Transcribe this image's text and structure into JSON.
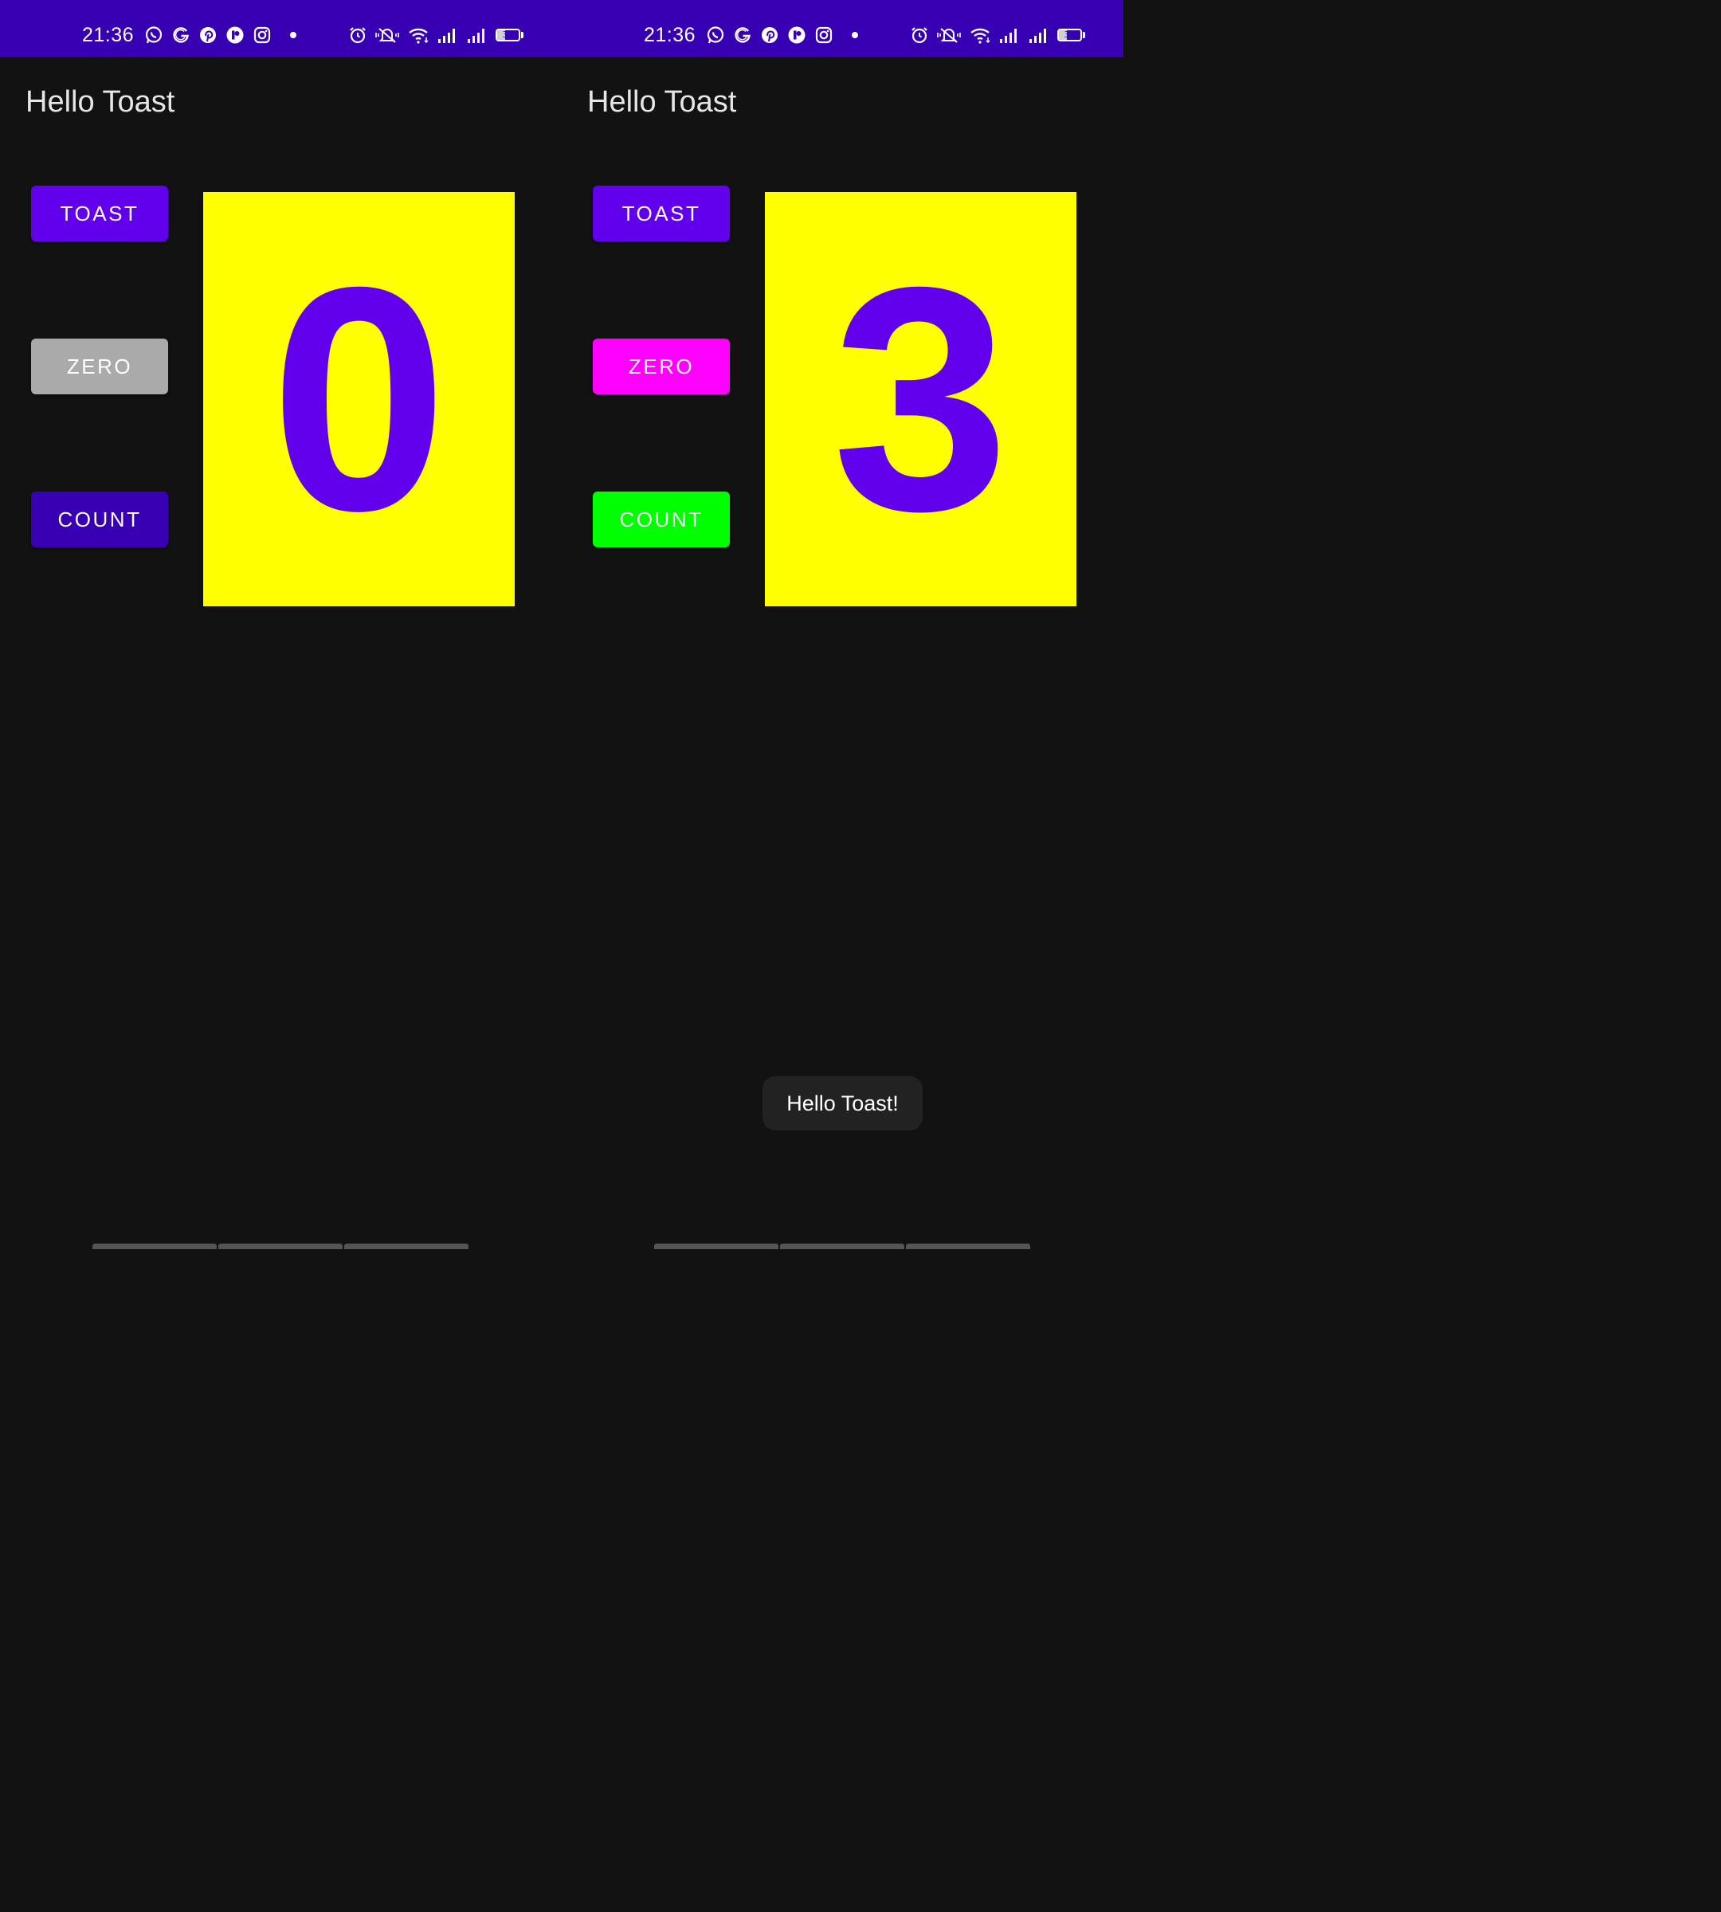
{
  "colors": {
    "status_bar": "#3700b3",
    "background": "#121212",
    "count_box_bg": "#ffff00",
    "count_text": "#6200ee",
    "toast_bg": "#222222"
  },
  "screens": [
    {
      "status_bar": {
        "time": "21:36",
        "battery_level": "37",
        "left_icons": [
          "whatsapp-icon",
          "google-icon",
          "pinterest-icon",
          "app-icon",
          "instagram-icon",
          "dot-icon"
        ],
        "right_icons": [
          "alarm-icon",
          "mute-icon",
          "wifi-icon",
          "signal-icon",
          "signal-icon",
          "battery-icon"
        ]
      },
      "app": {
        "title": "Hello Toast"
      },
      "buttons": {
        "toast": {
          "label": "TOAST",
          "color": "#6200ee"
        },
        "zero": {
          "label": "ZERO",
          "color": "#aaaaaa"
        },
        "count": {
          "label": "COUNT",
          "color": "#3700b3"
        }
      },
      "count_value": "0",
      "toast_message": ""
    },
    {
      "status_bar": {
        "time": "21:36",
        "battery_level": "37",
        "left_icons": [
          "whatsapp-icon",
          "google-icon",
          "pinterest-icon",
          "app-icon",
          "instagram-icon",
          "dot-icon"
        ],
        "right_icons": [
          "alarm-icon",
          "mute-icon",
          "wifi-icon",
          "signal-icon",
          "signal-icon",
          "battery-icon"
        ]
      },
      "app": {
        "title": "Hello Toast"
      },
      "buttons": {
        "toast": {
          "label": "TOAST",
          "color": "#6200ee"
        },
        "zero": {
          "label": "ZERO",
          "color": "#ff00ff"
        },
        "count": {
          "label": "COUNT",
          "color": "#00ff00"
        }
      },
      "count_value": "3",
      "toast_message": "Hello Toast!"
    }
  ]
}
